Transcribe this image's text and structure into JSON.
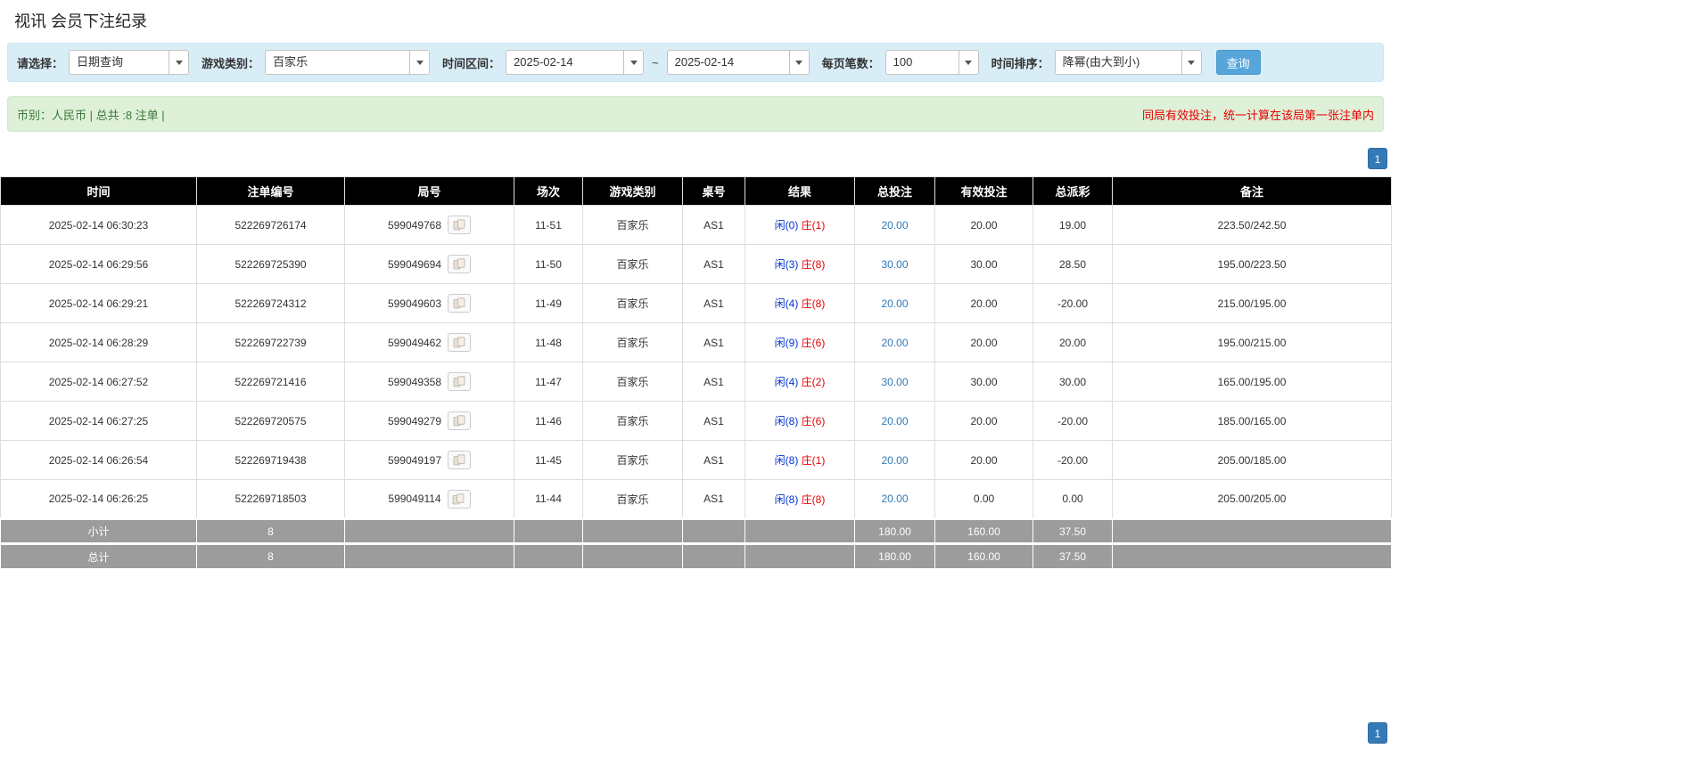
{
  "page": {
    "title": "视讯 会员下注纪录"
  },
  "filters": {
    "select_label": "请选择：",
    "select_value": "日期查询",
    "game_type_label": "游戏类别：",
    "game_type_value": "百家乐",
    "time_range_label": "时间区间：",
    "time_from": "2025-02-14",
    "time_to": "2025-02-14",
    "tilde": "~",
    "page_size_label": "每页笔数：",
    "page_size_value": "100",
    "sort_label": "时间排序：",
    "sort_value": "降幂(由大到小)",
    "search_button": "查询"
  },
  "summary": {
    "left": "币别：人民币 | 总共 :8 注单 |",
    "right": "同局有效投注，统一计算在该局第一张注单内"
  },
  "pagination": {
    "page": "1"
  },
  "icons": {
    "dropdown_arrow": "chevron-down-icon",
    "round_icon": "cards-icon"
  },
  "colors": {
    "header_bg": "#000000",
    "footer_bg": "#9c9c9c",
    "filter_bg": "#d9edf7",
    "summary_bg": "#dff0d8",
    "accent_blue": "#337ab7",
    "alert_red": "#e60000"
  },
  "table": {
    "headers": [
      "时间",
      "注单编号",
      "局号",
      "场次",
      "游戏类别",
      "桌号",
      "结果",
      "总投注",
      "有效投注",
      "总派彩",
      "备注"
    ],
    "rows": [
      {
        "time": "2025-02-14 06:30:23",
        "bet_id": "522269726174",
        "round": "599049768",
        "session": "11-51",
        "game": "百家乐",
        "table": "AS1",
        "result_player": "闲(0)",
        "result_banker": "庄(1)",
        "total_bet": "20.00",
        "valid_bet": "20.00",
        "payout": "19.00",
        "remark": "223.50/242.50"
      },
      {
        "time": "2025-02-14 06:29:56",
        "bet_id": "522269725390",
        "round": "599049694",
        "session": "11-50",
        "game": "百家乐",
        "table": "AS1",
        "result_player": "闲(3)",
        "result_banker": "庄(8)",
        "total_bet": "30.00",
        "valid_bet": "30.00",
        "payout": "28.50",
        "remark": "195.00/223.50"
      },
      {
        "time": "2025-02-14 06:29:21",
        "bet_id": "522269724312",
        "round": "599049603",
        "session": "11-49",
        "game": "百家乐",
        "table": "AS1",
        "result_player": "闲(4)",
        "result_banker": "庄(8)",
        "total_bet": "20.00",
        "valid_bet": "20.00",
        "payout": "-20.00",
        "remark": "215.00/195.00"
      },
      {
        "time": "2025-02-14 06:28:29",
        "bet_id": "522269722739",
        "round": "599049462",
        "session": "11-48",
        "game": "百家乐",
        "table": "AS1",
        "result_player": "闲(9)",
        "result_banker": "庄(6)",
        "total_bet": "20.00",
        "valid_bet": "20.00",
        "payout": "20.00",
        "remark": "195.00/215.00"
      },
      {
        "time": "2025-02-14 06:27:52",
        "bet_id": "522269721416",
        "round": "599049358",
        "session": "11-47",
        "game": "百家乐",
        "table": "AS1",
        "result_player": "闲(4)",
        "result_banker": "庄(2)",
        "total_bet": "30.00",
        "valid_bet": "30.00",
        "payout": "30.00",
        "remark": "165.00/195.00"
      },
      {
        "time": "2025-02-14 06:27:25",
        "bet_id": "522269720575",
        "round": "599049279",
        "session": "11-46",
        "game": "百家乐",
        "table": "AS1",
        "result_player": "闲(8)",
        "result_banker": "庄(6)",
        "total_bet": "20.00",
        "valid_bet": "20.00",
        "payout": "-20.00",
        "remark": "185.00/165.00"
      },
      {
        "time": "2025-02-14 06:26:54",
        "bet_id": "522269719438",
        "round": "599049197",
        "session": "11-45",
        "game": "百家乐",
        "table": "AS1",
        "result_player": "闲(8)",
        "result_banker": "庄(1)",
        "total_bet": "20.00",
        "valid_bet": "20.00",
        "payout": "-20.00",
        "remark": "205.00/185.00"
      },
      {
        "time": "2025-02-14 06:26:25",
        "bet_id": "522269718503",
        "round": "599049114",
        "session": "11-44",
        "game": "百家乐",
        "table": "AS1",
        "result_player": "闲(8)",
        "result_banker": "庄(8)",
        "total_bet": "20.00",
        "valid_bet": "0.00",
        "payout": "0.00",
        "remark": "205.00/205.00"
      }
    ],
    "subtotal": {
      "label": "小计",
      "count": "8",
      "total_bet": "180.00",
      "valid_bet": "160.00",
      "payout": "37.50"
    },
    "total": {
      "label": "总计",
      "count": "8",
      "total_bet": "180.00",
      "valid_bet": "160.00",
      "payout": "37.50"
    }
  }
}
